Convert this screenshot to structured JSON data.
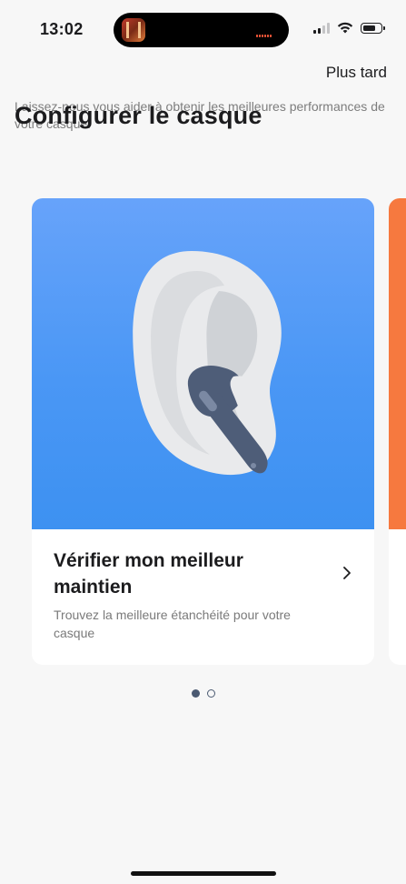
{
  "status_bar": {
    "time": "13:02",
    "icons": [
      "cellular-signal-icon",
      "wifi-icon",
      "battery-icon"
    ],
    "battery_level": 0.75
  },
  "header": {
    "later_label": "Plus tard",
    "subtitle": "Laissez-nous vous aider à obtenir les meilleures performances de votre casque.",
    "title": "Configurer le casque"
  },
  "cards": [
    {
      "title": "Vérifier mon meilleur maintien",
      "description": "Trouvez la meilleure étanchéité pour votre casque",
      "image": "ear-earbud-illustration",
      "image_color": "#4a97f5",
      "icon": "chevron-right-icon"
    },
    {
      "image_color": "#f6793f"
    }
  ],
  "pager": {
    "total": 2,
    "current": 1
  }
}
